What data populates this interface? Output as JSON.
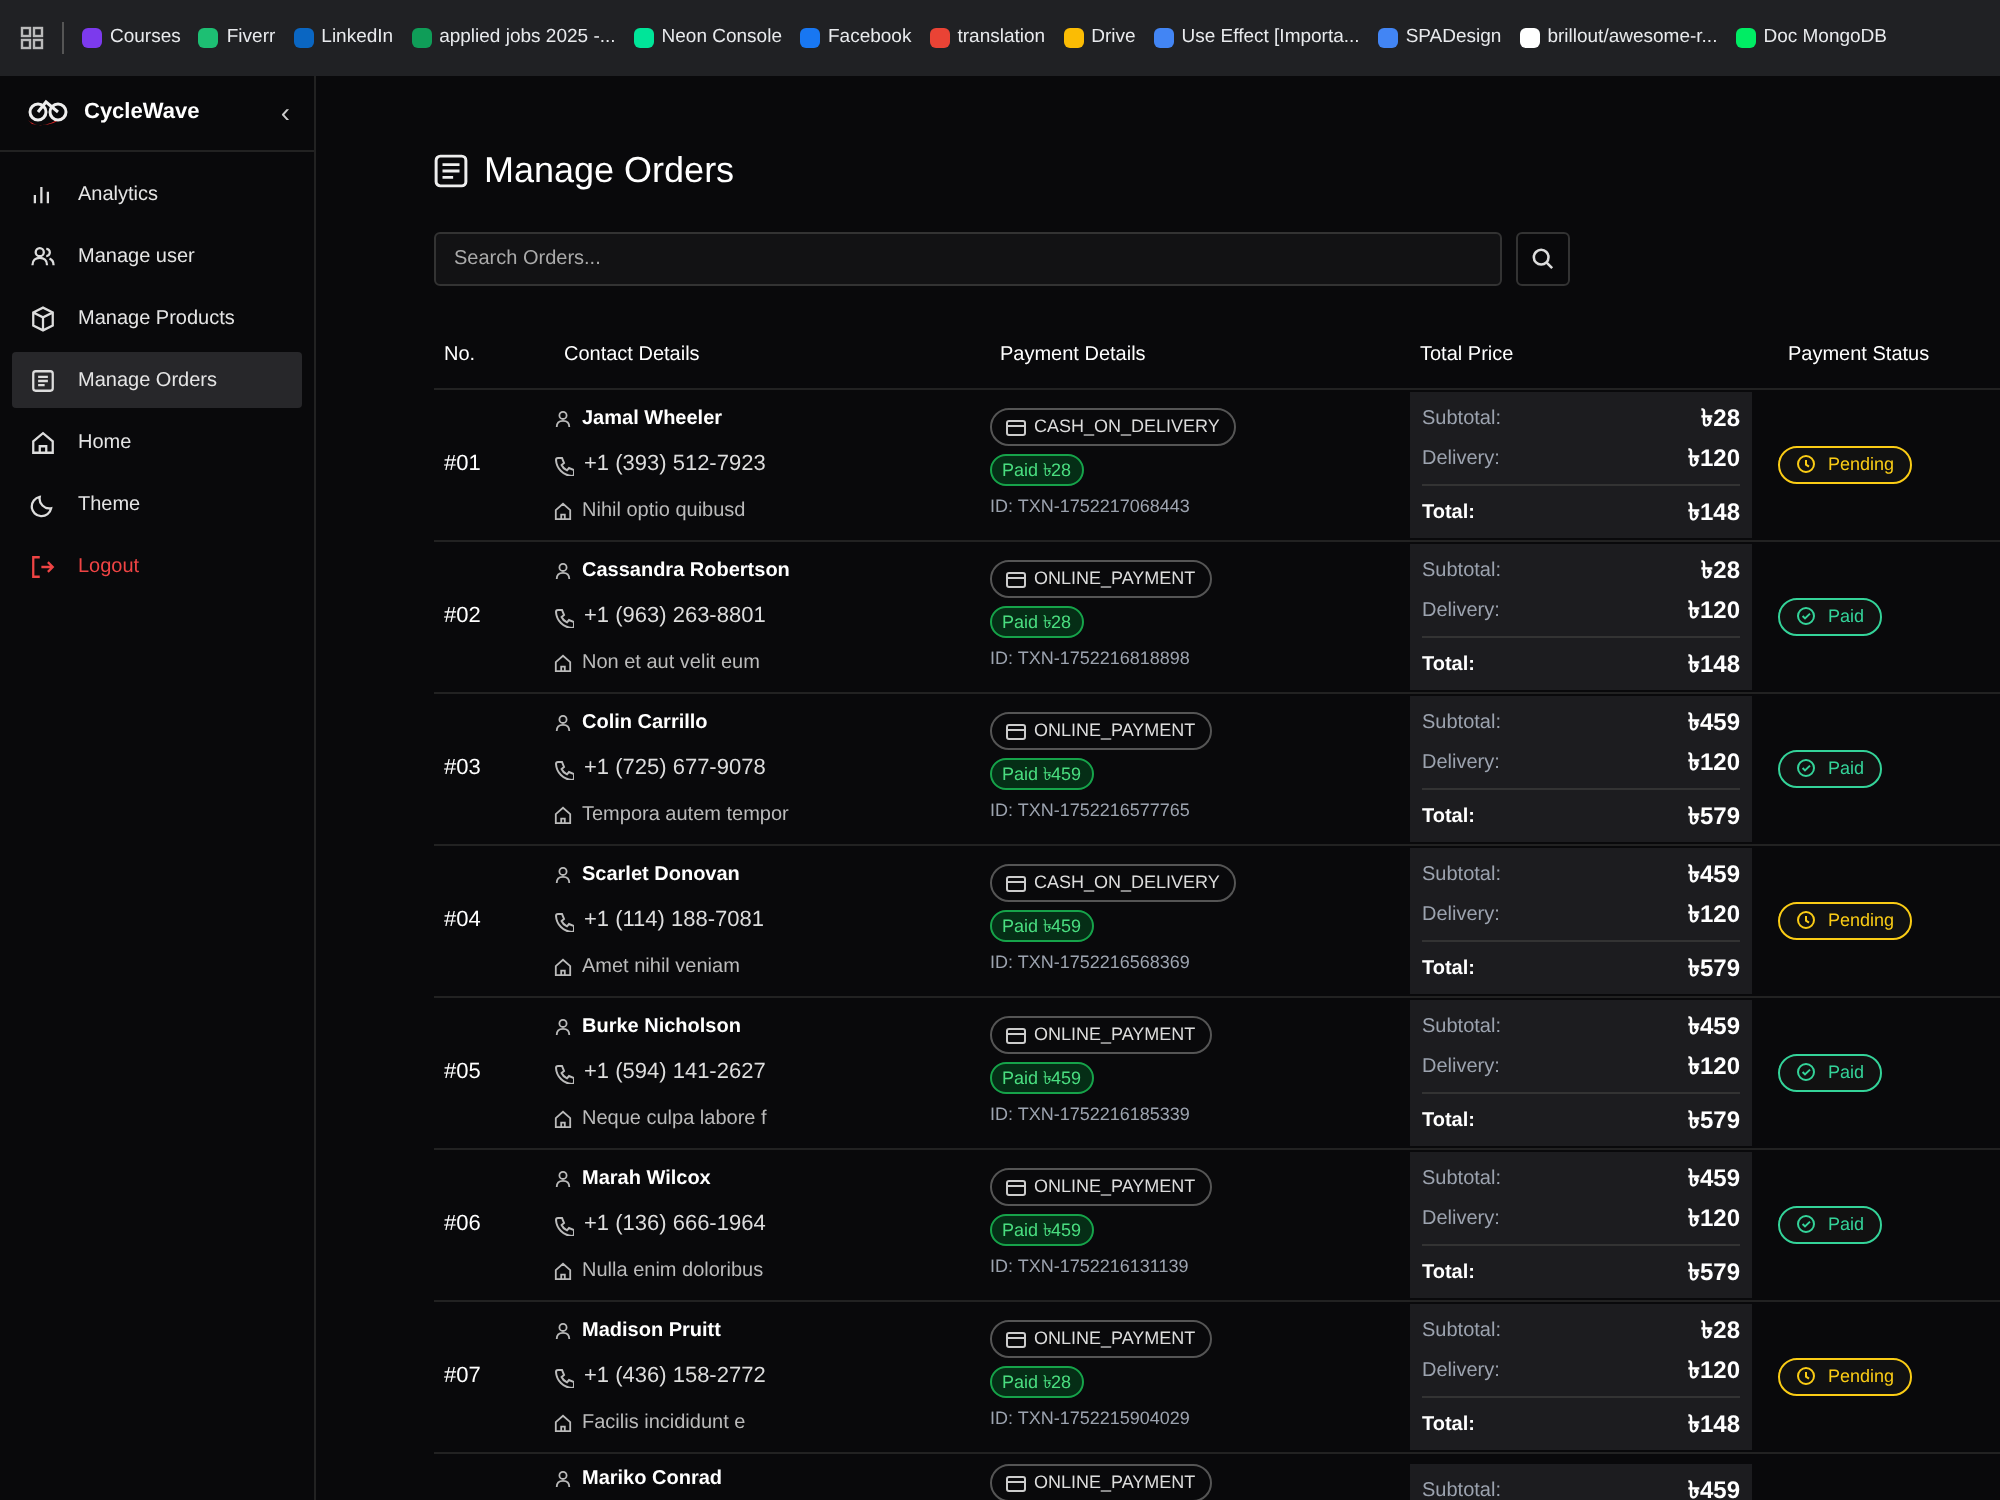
{
  "bookmarks": [
    {
      "label": "Courses",
      "color": "#7c3aed"
    },
    {
      "label": "Fiverr",
      "color": "#1dbf73"
    },
    {
      "label": "LinkedIn",
      "color": "#0a66c2"
    },
    {
      "label": "applied jobs 2025 -...",
      "color": "#0f9d58"
    },
    {
      "label": "Neon Console",
      "color": "#00e599"
    },
    {
      "label": "Facebook",
      "color": "#1877f2"
    },
    {
      "label": "translation",
      "color": "#ea4335"
    },
    {
      "label": "Drive",
      "color": "#fbbc04"
    },
    {
      "label": "Use Effect [Importa...",
      "color": "#4285f4"
    },
    {
      "label": "SPADesign",
      "color": "#4285f4"
    },
    {
      "label": "brillout/awesome-r...",
      "color": "#ffffff"
    },
    {
      "label": "Doc MongoDB",
      "color": "#00ed64"
    }
  ],
  "sidebar": {
    "brand": "CycleWave",
    "collapse": "‹",
    "items": [
      {
        "label": "Analytics",
        "kind": "analytics",
        "selected": false
      },
      {
        "label": "Manage user",
        "kind": "users",
        "selected": false
      },
      {
        "label": "Manage Products",
        "kind": "products",
        "selected": false
      },
      {
        "label": "Manage Orders",
        "kind": "orders",
        "selected": true
      },
      {
        "label": "Home",
        "kind": "home",
        "selected": false
      },
      {
        "label": "Theme",
        "kind": "theme",
        "selected": false
      },
      {
        "label": "Logout",
        "kind": "logout",
        "selected": false
      }
    ]
  },
  "page": {
    "title": "Manage Orders",
    "search": {
      "placeholder": "Search Orders..."
    }
  },
  "table": {
    "columns": [
      "No.",
      "Contact Details",
      "Payment Details",
      "Total Price",
      "Payment Status"
    ],
    "rows": [
      {
        "no": "#01",
        "name": "Jamal Wheeler",
        "phone": "+1 (393) 512-7923",
        "address": "Nihil optio quibusd",
        "method": "CASH_ON_DELIVERY",
        "paid": "Paid ৳28",
        "txn": "ID: TXN-1752217068443",
        "subtotal_label": "Subtotal:",
        "subtotal": "৳28",
        "delivery_label": "Delivery:",
        "delivery": "৳120",
        "total_label": "Total:",
        "total": "৳148",
        "status": "Pending",
        "color": "#facc15"
      },
      {
        "no": "#02",
        "name": "Cassandra Robertson",
        "phone": "+1 (963) 263-8801",
        "address": "Non et aut velit eum",
        "method": "ONLINE_PAYMENT",
        "paid": "Paid ৳28",
        "txn": "ID: TXN-1752216818898",
        "subtotal_label": "Subtotal:",
        "subtotal": "৳28",
        "delivery_label": "Delivery:",
        "delivery": "৳120",
        "total_label": "Total:",
        "total": "৳148",
        "status": "Paid",
        "color": "#34d399"
      },
      {
        "no": "#03",
        "name": "Colin Carrillo",
        "phone": "+1 (725) 677-9078",
        "address": "Tempora autem tempor",
        "method": "ONLINE_PAYMENT",
        "paid": "Paid ৳459",
        "txn": "ID: TXN-1752216577765",
        "subtotal_label": "Subtotal:",
        "subtotal": "৳459",
        "delivery_label": "Delivery:",
        "delivery": "৳120",
        "total_label": "Total:",
        "total": "৳579",
        "status": "Paid",
        "color": "#34d399"
      },
      {
        "no": "#04",
        "name": "Scarlet Donovan",
        "phone": "+1 (114) 188-7081",
        "address": "Amet nihil veniam",
        "method": "CASH_ON_DELIVERY",
        "paid": "Paid ৳459",
        "txn": "ID: TXN-1752216568369",
        "subtotal_label": "Subtotal:",
        "subtotal": "৳459",
        "delivery_label": "Delivery:",
        "delivery": "৳120",
        "total_label": "Total:",
        "total": "৳579",
        "status": "Pending",
        "color": "#facc15"
      },
      {
        "no": "#05",
        "name": "Burke Nicholson",
        "phone": "+1 (594) 141-2627",
        "address": "Neque culpa labore f",
        "method": "ONLINE_PAYMENT",
        "paid": "Paid ৳459",
        "txn": "ID: TXN-1752216185339",
        "subtotal_label": "Subtotal:",
        "subtotal": "৳459",
        "delivery_label": "Delivery:",
        "delivery": "৳120",
        "total_label": "Total:",
        "total": "৳579",
        "status": "Paid",
        "color": "#34d399"
      },
      {
        "no": "#06",
        "name": "Marah Wilcox",
        "phone": "+1 (136) 666-1964",
        "address": "Nulla enim doloribus",
        "method": "ONLINE_PAYMENT",
        "paid": "Paid ৳459",
        "txn": "ID: TXN-1752216131139",
        "subtotal_label": "Subtotal:",
        "subtotal": "৳459",
        "delivery_label": "Delivery:",
        "delivery": "৳120",
        "total_label": "Total:",
        "total": "৳579",
        "status": "Paid",
        "color": "#34d399"
      },
      {
        "no": "#07",
        "name": "Madison Pruitt",
        "phone": "+1 (436) 158-2772",
        "address": "Facilis incididunt e",
        "method": "ONLINE_PAYMENT",
        "paid": "Paid ৳28",
        "txn": "ID: TXN-1752215904029",
        "subtotal_label": "Subtotal:",
        "subtotal": "৳28",
        "delivery_label": "Delivery:",
        "delivery": "৳120",
        "total_label": "Total:",
        "total": "৳148",
        "status": "Pending",
        "color": "#facc15"
      },
      {
        "name": "Mariko Conrad",
        "method": "ONLINE_PAYMENT",
        "subtotal_label": "Subtotal:",
        "subtotal": "৳459"
      }
    ]
  }
}
